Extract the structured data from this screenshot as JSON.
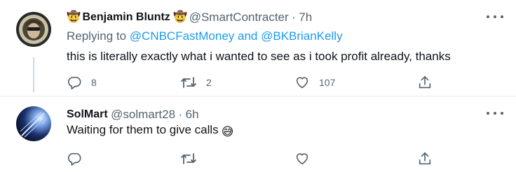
{
  "tweets": [
    {
      "display_name": "Benjamin Bluntz",
      "handle": "@SmartContracter",
      "separator": "·",
      "time": "7h",
      "replying_label": "Replying to ",
      "mention1": "@CNBCFastMoney",
      "and": " and ",
      "mention2": "@BKBrianKelly",
      "text": "this is literally exactly what i wanted to see as i took profit already, thanks",
      "replies": "8",
      "retweets": "2",
      "likes": "107"
    },
    {
      "display_name": "SolMart",
      "handle": "@solmart28",
      "separator": "·",
      "time": "6h",
      "text": "Waiting for them to give calls",
      "replies": "",
      "retweets": "",
      "likes": ""
    }
  ],
  "icons": {
    "name_emoji": "🤠",
    "text_emoji": "😅",
    "reply": "reply-icon",
    "retweet": "retweet-icon",
    "like": "heart-icon",
    "share": "share-icon",
    "more": "more-icon"
  },
  "colors": {
    "link": "#1d9bf0",
    "secondary": "#536471",
    "text": "#0f1419",
    "divider": "#e6ecf0"
  }
}
